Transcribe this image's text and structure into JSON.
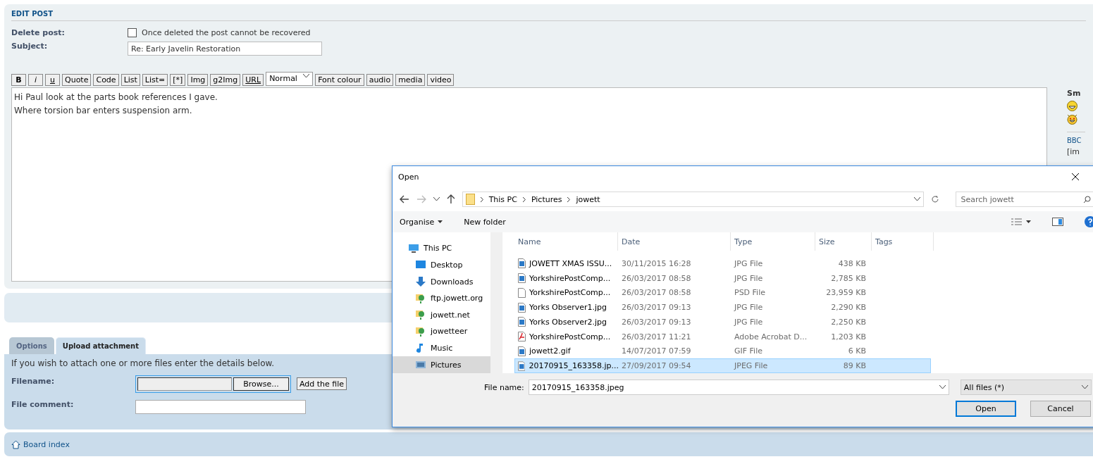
{
  "edit_post": {
    "heading": "EDIT POST",
    "delete_post": {
      "label": "Delete post:",
      "checked": false,
      "text": "Once deleted the post cannot be recovered"
    },
    "subject": {
      "label": "Subject:",
      "value": "Re: Early Javelin Restoration"
    },
    "toolbar": [
      {
        "label": "B",
        "kind": "bold"
      },
      {
        "label": "i",
        "kind": "italic"
      },
      {
        "label": "u",
        "kind": "underline"
      },
      {
        "label": "Quote",
        "kind": "plain"
      },
      {
        "label": "Code",
        "kind": "plain"
      },
      {
        "label": "List",
        "kind": "plain"
      },
      {
        "label": "List=",
        "kind": "plain"
      },
      {
        "label": "[*]",
        "kind": "plain"
      },
      {
        "label": "Img",
        "kind": "plain"
      },
      {
        "label": "g2Img",
        "kind": "plain"
      },
      {
        "label": "URL",
        "kind": "underline"
      },
      {
        "label": "Normal",
        "kind": "select"
      },
      {
        "label": "Font colour",
        "kind": "plain"
      },
      {
        "label": "audio",
        "kind": "plain"
      },
      {
        "label": "media",
        "kind": "plain"
      },
      {
        "label": "video",
        "kind": "plain"
      }
    ],
    "message": [
      "Hi Paul look at the parts book references I gave.",
      "Where torsion bar enters suspension arm."
    ],
    "side": {
      "smilies_heading": "Sm",
      "bbcode_heading": "BBC",
      "bbcode_text": "[im"
    }
  },
  "tabs": [
    {
      "label": "Options",
      "selected": false
    },
    {
      "label": "Upload attachment",
      "selected": true
    }
  ],
  "upload": {
    "intro": "If you wish to attach one or more files enter the details below.",
    "filename_label": "Filename:",
    "browse": "Browse...",
    "add": "Add the file",
    "comment_label": "File comment:"
  },
  "footer": {
    "board_index": "Board index"
  },
  "dialog": {
    "title": "Open",
    "path": [
      "This PC",
      "Pictures",
      "jowett"
    ],
    "search_placeholder": "Search jowett",
    "organise": "Organise",
    "new_folder": "New folder",
    "nav": [
      {
        "label": "This PC",
        "kind": "pc",
        "selected": false
      },
      {
        "label": "Desktop",
        "kind": "desktop",
        "selected": false
      },
      {
        "label": "Downloads",
        "kind": "download",
        "selected": false
      },
      {
        "label": "ftp.jowett.org",
        "kind": "net",
        "selected": false
      },
      {
        "label": "jowett.net",
        "kind": "net",
        "selected": false
      },
      {
        "label": "jowetteer",
        "kind": "net",
        "selected": false
      },
      {
        "label": "Music",
        "kind": "music",
        "selected": false
      },
      {
        "label": "Pictures",
        "kind": "pictures",
        "selected": true
      }
    ],
    "columns": [
      "Name",
      "Date",
      "Type",
      "Size",
      "Tags"
    ],
    "files": [
      {
        "name": "JOWETT XMAS ISSU...",
        "date": "30/11/2015 16:28",
        "type": "JPG File",
        "size": "438 KB",
        "kind": "image",
        "selected": false
      },
      {
        "name": "YorkshirePostComp...",
        "date": "26/03/2017 08:58",
        "type": "JPG File",
        "size": "2,785 KB",
        "kind": "image",
        "selected": false
      },
      {
        "name": "YorkshirePostComp...",
        "date": "26/03/2017 08:58",
        "type": "PSD File",
        "size": "23,959 KB",
        "kind": "blank",
        "selected": false
      },
      {
        "name": "Yorks Observer1.jpg",
        "date": "26/03/2017 09:13",
        "type": "JPG File",
        "size": "2,290 KB",
        "kind": "image",
        "selected": false
      },
      {
        "name": "Yorks Observer2.jpg",
        "date": "26/03/2017 09:13",
        "type": "JPG File",
        "size": "2,250 KB",
        "kind": "image",
        "selected": false
      },
      {
        "name": "YorkshirePostComp...",
        "date": "26/03/2017 11:21",
        "type": "Adobe Acrobat D...",
        "size": "1,203 KB",
        "kind": "pdf",
        "selected": false
      },
      {
        "name": "jowett2.gif",
        "date": "14/07/2017 07:59",
        "type": "GIF File",
        "size": "6 KB",
        "kind": "image",
        "selected": false
      },
      {
        "name": "20170915_163358.jp...",
        "date": "27/09/2017 09:54",
        "type": "JPEG File",
        "size": "89 KB",
        "kind": "image",
        "selected": true
      }
    ],
    "file_name_label": "File name:",
    "file_name": "20170915_163358.jpeg",
    "filter": "All files (*)",
    "open": "Open",
    "cancel": "Cancel"
  }
}
